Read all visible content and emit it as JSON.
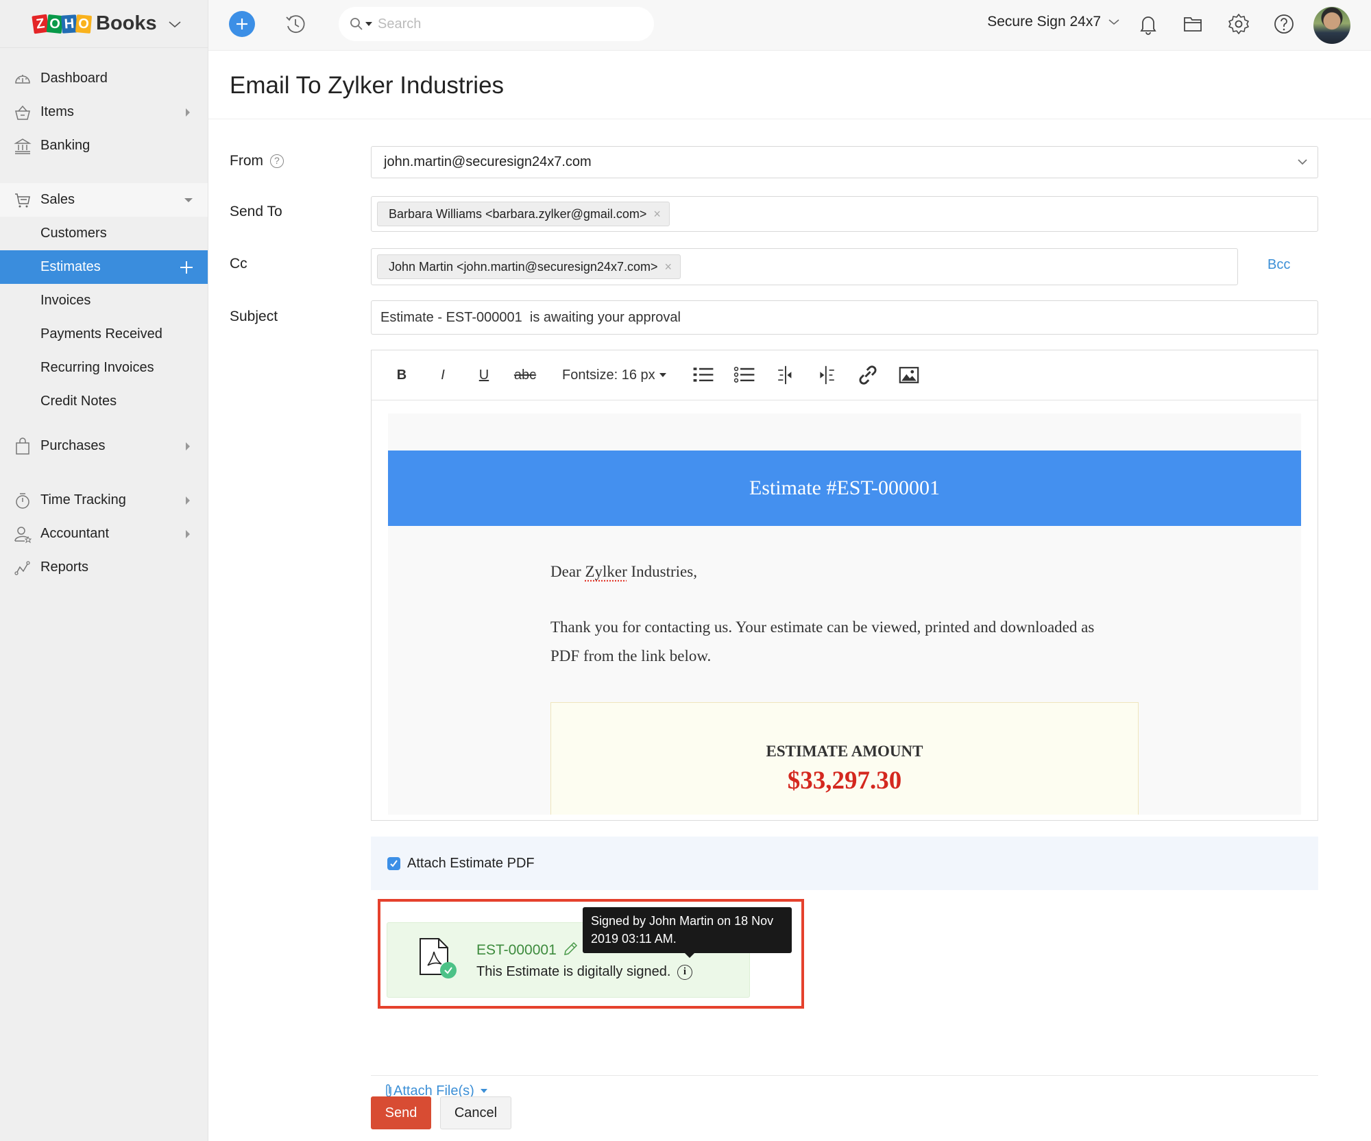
{
  "brand": {
    "name": "Books",
    "logo_letters": [
      "Z",
      "O",
      "H",
      "O"
    ]
  },
  "topbar": {
    "search_placeholder": "Search",
    "org_name": "Secure Sign 24x7",
    "icons": [
      "plus-icon",
      "history-icon",
      "search-icon",
      "bell-icon",
      "folder-icon",
      "gear-icon",
      "help-icon",
      "avatar"
    ]
  },
  "sidebar": {
    "items": [
      {
        "label": "Dashboard",
        "icon": "dashboard-icon"
      },
      {
        "label": "Items",
        "icon": "basket-icon",
        "has_submenu": true
      },
      {
        "label": "Banking",
        "icon": "bank-icon"
      },
      {
        "label": "Sales",
        "icon": "cart-icon",
        "expanded": true
      },
      {
        "label": "Customers"
      },
      {
        "label": "Estimates",
        "active": true
      },
      {
        "label": "Invoices"
      },
      {
        "label": "Payments Received"
      },
      {
        "label": "Recurring Invoices"
      },
      {
        "label": "Credit Notes"
      },
      {
        "label": "Purchases",
        "icon": "bag-icon",
        "has_submenu": true
      },
      {
        "label": "Time Tracking",
        "icon": "stopwatch-icon",
        "has_submenu": true
      },
      {
        "label": "Accountant",
        "icon": "accountant-icon",
        "has_submenu": true
      },
      {
        "label": "Reports",
        "icon": "reports-icon"
      }
    ]
  },
  "page": {
    "title": "Email To Zylker Industries",
    "labels": {
      "from": "From",
      "send_to": "Send To",
      "cc": "Cc",
      "subject": "Subject"
    },
    "from_value": "john.martin@securesign24x7.com",
    "send_to_tags": [
      "Barbara Williams <barbara.zylker@gmail.com>"
    ],
    "cc_tags": [
      "John Martin <john.martin@securesign24x7.com>"
    ],
    "bcc_label": "Bcc",
    "subject_value": "Estimate - EST-000001  is awaiting your approval",
    "tag_remove": "×"
  },
  "editor": {
    "toolbar": {
      "bold": "B",
      "italic": "I",
      "underline": "U",
      "strike": "abc",
      "fontsize": "Fontsize: 16 px"
    },
    "banner_title": "Estimate #EST-000001",
    "greeting_prefix": "Dear ",
    "greeting_name": "Zylker",
    "greeting_suffix": " Industries,",
    "body_line1": "Thank you for contacting us. Your estimate can be viewed, printed and downloaded as",
    "body_line2": "PDF from the link below.",
    "amount_label": "ESTIMATE AMOUNT",
    "amount_value": "$33,297.30"
  },
  "attachments": {
    "attach_pdf_label": "Attach Estimate PDF",
    "attach_pdf_checked": true,
    "signed_file_name": "EST-000001",
    "signed_text": "This Estimate is digitally signed.",
    "info_glyph": "i",
    "tooltip_line1": "Signed by John Martin on 18 Nov",
    "tooltip_line2": "2019 03:11 AM.",
    "attach_files_label": "Attach File(s)"
  },
  "actions": {
    "send": "Send",
    "cancel": "Cancel"
  },
  "colors": {
    "accent": "#3a8ddd",
    "send": "#d84c33",
    "banner": "#4490ef",
    "amount": "#d4281f",
    "highlight": "#e5412d",
    "signed_bg": "#ecf8e8"
  }
}
